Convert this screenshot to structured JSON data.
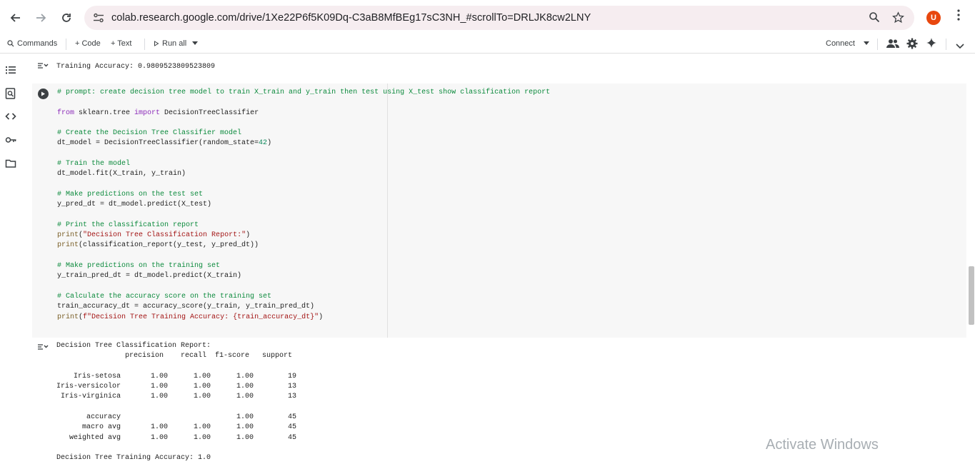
{
  "browser": {
    "url": "colab.research.google.com/drive/1Xe22P6f5K09Dq-C3aB8MfBEg17sC3NH_#scrollTo=DRLJK8cw2LNY",
    "avatar_initial": "U"
  },
  "toolbar": {
    "commands_label": "Commands",
    "code_label": "+ Code",
    "text_label": "+ Text",
    "run_all_label": "Run all",
    "connect_label": "Connect"
  },
  "previous_output": "Training Accuracy: 0.9809523809523809",
  "code_cell": {
    "lines": [
      {
        "cls": "c-comment",
        "text": "# prompt: create decision tree model to train X_train and y_train then test using X_test show classification report"
      },
      {
        "cls": "",
        "text": ""
      },
      {
        "cls": "",
        "text": "from sklearn.tree import DecisionTreeClassifier"
      },
      {
        "cls": "",
        "text": ""
      },
      {
        "cls": "c-comment",
        "text": "# Create the Decision Tree Classifier model"
      },
      {
        "cls": "",
        "text": "dt_model = DecisionTreeClassifier(random_state=42)"
      },
      {
        "cls": "",
        "text": ""
      },
      {
        "cls": "c-comment",
        "text": "# Train the model"
      },
      {
        "cls": "",
        "text": "dt_model.fit(X_train, y_train)"
      },
      {
        "cls": "",
        "text": ""
      },
      {
        "cls": "c-comment",
        "text": "# Make predictions on the test set"
      },
      {
        "cls": "",
        "text": "y_pred_dt = dt_model.predict(X_test)"
      },
      {
        "cls": "",
        "text": ""
      },
      {
        "cls": "c-comment",
        "text": "# Print the classification report"
      },
      {
        "cls": "",
        "text": "print(\"Decision Tree Classification Report:\")"
      },
      {
        "cls": "",
        "text": "print(classification_report(y_test, y_pred_dt))"
      },
      {
        "cls": "",
        "text": ""
      },
      {
        "cls": "c-comment",
        "text": "# Make predictions on the training set"
      },
      {
        "cls": "",
        "text": "y_train_pred_dt = dt_model.predict(X_train)"
      },
      {
        "cls": "",
        "text": ""
      },
      {
        "cls": "c-comment",
        "text": "# Calculate the accuracy score on the training set"
      },
      {
        "cls": "",
        "text": "train_accuracy_dt = accuracy_score(y_train, y_train_pred_dt)"
      },
      {
        "cls": "",
        "text": "print(f\"Decision Tree Training Accuracy: {train_accuracy_dt}\")"
      }
    ]
  },
  "output": {
    "lines": [
      "Decision Tree Classification Report:",
      "                precision    recall  f1-score   support",
      "",
      "    Iris-setosa       1.00      1.00      1.00        19",
      "Iris-versicolor       1.00      1.00      1.00        13",
      " Iris-virginica       1.00      1.00      1.00        13",
      "",
      "       accuracy                           1.00        45",
      "      macro avg       1.00      1.00      1.00        45",
      "   weighted avg       1.00      1.00      1.00        45",
      "",
      "Decision Tree Training Accuracy: 1.0"
    ]
  },
  "watermark": "Activate Windows"
}
